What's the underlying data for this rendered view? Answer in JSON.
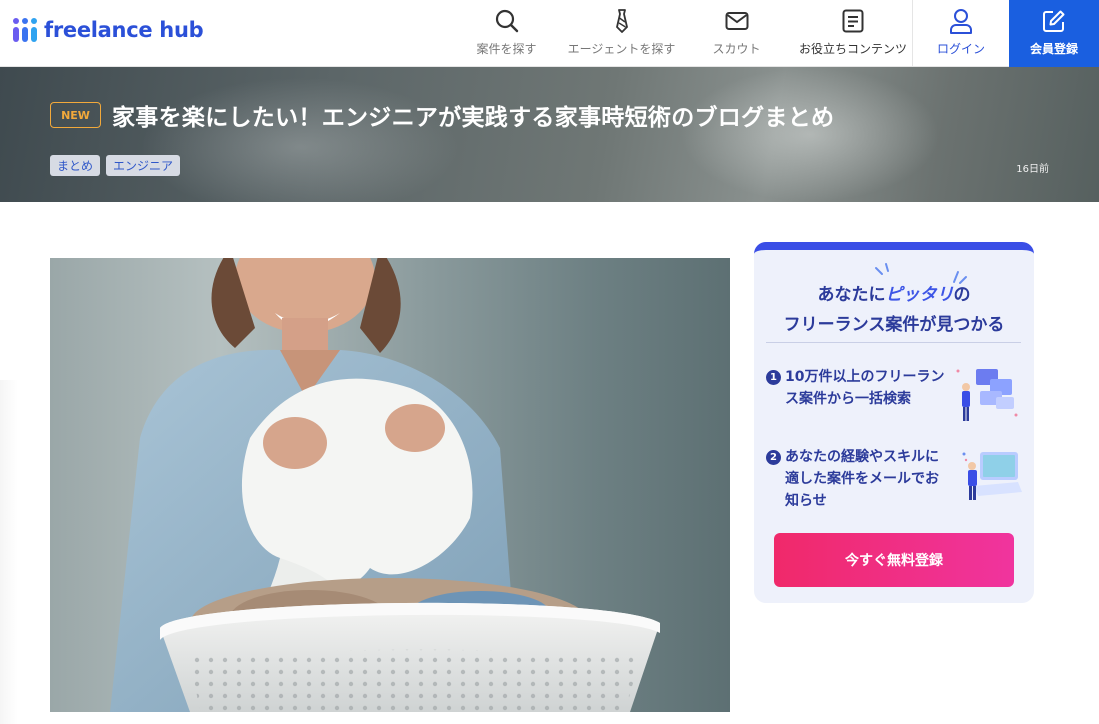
{
  "header": {
    "logo_text": "freelance hub",
    "nav": [
      {
        "label": "案件を探す",
        "icon": "search-icon"
      },
      {
        "label": "エージェントを探す",
        "icon": "tie-icon"
      },
      {
        "label": "スカウト",
        "icon": "mail-icon"
      },
      {
        "label": "お役立ちコンテンツ",
        "icon": "document-icon"
      },
      {
        "label": "ログイン",
        "icon": "user-icon"
      },
      {
        "label": "会員登録",
        "icon": "edit-icon"
      }
    ]
  },
  "hero": {
    "badge": "NEW",
    "title": "家事を楽にしたい！エンジニアが実践する家事時短術のブログまとめ",
    "tags": [
      "まとめ",
      "エンジニア"
    ],
    "date": "16日前"
  },
  "sidebar": {
    "heading_pre": "あなたに",
    "heading_accent": "ピッタリ",
    "heading_post": "の",
    "heading_line2": "フリーランス案件が見つかる",
    "points": [
      {
        "num": "1",
        "text": "10万件以上のフリーランス案件から一括検索"
      },
      {
        "num": "2",
        "text": "あなたの経験やスキルに適した案件をメールでお知らせ"
      }
    ],
    "cta_label": "今すぐ無料登録"
  },
  "colors": {
    "brand_blue": "#2b50d8",
    "register_blue": "#1a5fe0",
    "badge_orange": "#f2a93b",
    "cta_pink": "#f0296a"
  }
}
